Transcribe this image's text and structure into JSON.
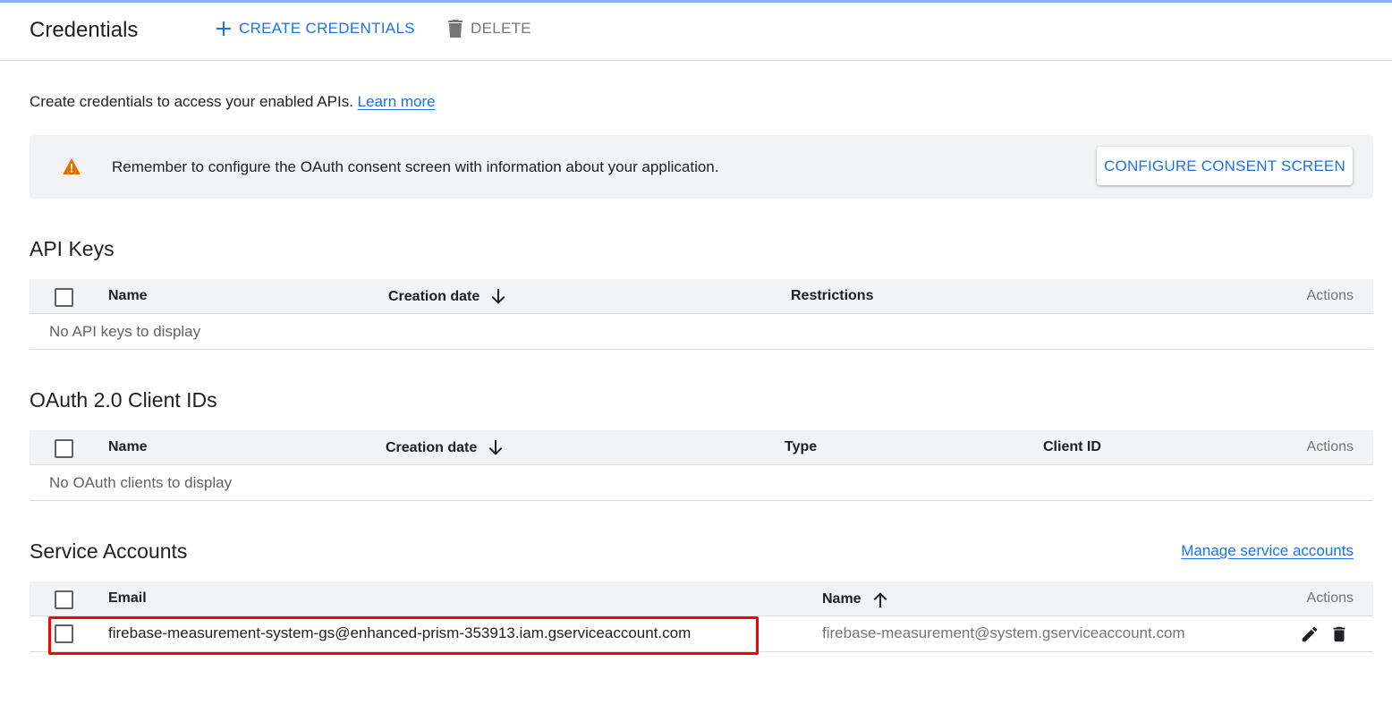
{
  "header": {
    "title": "Credentials",
    "create_label": "CREATE CREDENTIALS",
    "delete_label": "DELETE"
  },
  "intro": {
    "text": "Create credentials to access your enabled APIs.",
    "link": "Learn more"
  },
  "banner": {
    "message": "Remember to configure the OAuth consent screen with information about your application.",
    "button": "CONFIGURE CONSENT SCREEN",
    "icon": "warning-icon",
    "icon_color": "#e37400"
  },
  "api_keys": {
    "title": "API Keys",
    "columns": {
      "name": "Name",
      "creation_date": "Creation date",
      "restrictions": "Restrictions",
      "actions": "Actions"
    },
    "empty": "No API keys to display"
  },
  "oauth": {
    "title": "OAuth 2.0 Client IDs",
    "columns": {
      "name": "Name",
      "creation_date": "Creation date",
      "type": "Type",
      "client_id": "Client ID",
      "actions": "Actions"
    },
    "empty": "No OAuth clients to display"
  },
  "service_accounts": {
    "title": "Service Accounts",
    "manage_link": "Manage service accounts",
    "columns": {
      "email": "Email",
      "name": "Name",
      "actions": "Actions"
    },
    "rows": [
      {
        "email": "firebase-measurement-system-gs@enhanced-prism-353913.iam.gserviceaccount.com",
        "name": "firebase-measurement@system.gserviceaccount.com"
      }
    ]
  },
  "colors": {
    "accent": "#1a73e8",
    "highlight": "#ff0000",
    "header_bg": "#f1f3f4"
  }
}
